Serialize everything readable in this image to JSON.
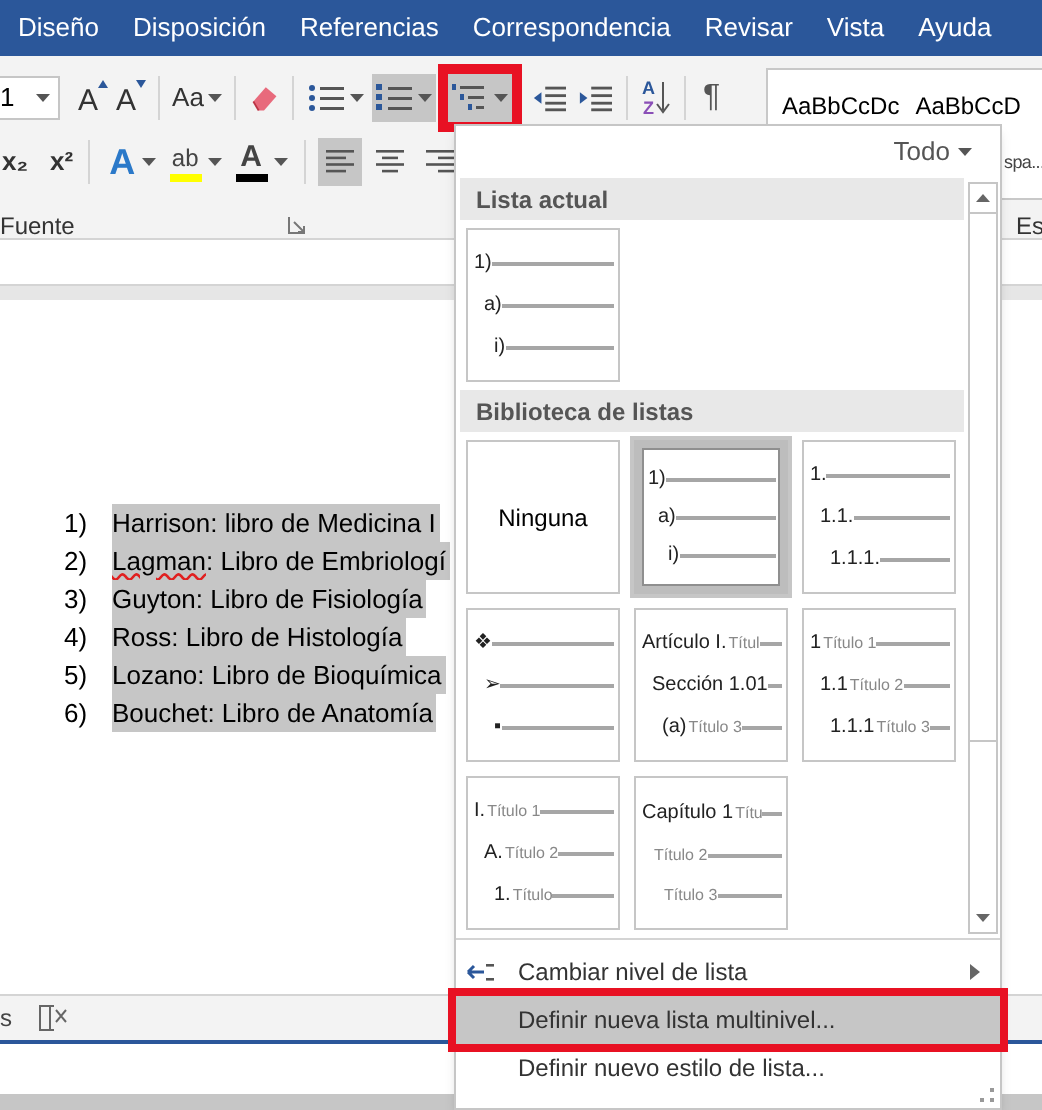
{
  "tabs": [
    {
      "label": "Diseño"
    },
    {
      "label": "Disposición"
    },
    {
      "label": "Referencias"
    },
    {
      "label": "Correspondencia"
    },
    {
      "label": "Revisar"
    },
    {
      "label": "Vista"
    },
    {
      "label": "Ayuda"
    }
  ],
  "ribbon": {
    "font_size": "1",
    "row1": [
      {
        "kind": "grow",
        "glyph": "A"
      },
      {
        "kind": "shrink",
        "glyph": "A"
      },
      {
        "kind": "sep"
      },
      {
        "kind": "case",
        "glyph": "Aa"
      },
      {
        "kind": "sep"
      },
      {
        "kind": "eraser"
      },
      {
        "kind": "sep"
      },
      {
        "kind": "bullets",
        "active": false,
        "outlined": false
      },
      {
        "kind": "numbering",
        "active": true,
        "outlined": false
      },
      {
        "kind": "multilevel",
        "active": true,
        "outlined": true
      },
      {
        "kind": "outdent"
      },
      {
        "kind": "indent"
      },
      {
        "kind": "sep"
      },
      {
        "kind": "sort",
        "glyph": "A",
        "glyph2": "Z"
      },
      {
        "kind": "sep"
      },
      {
        "kind": "pilcrow",
        "glyph": "¶"
      }
    ],
    "row2": [
      {
        "kind": "sub",
        "glyph": "x",
        "glyph2": "₂"
      },
      {
        "kind": "sup",
        "glyph": "x",
        "glyph2": "²"
      },
      {
        "kind": "sep"
      },
      {
        "kind": "effects",
        "glyph": "A"
      },
      {
        "kind": "highlight",
        "glyph": "ab"
      },
      {
        "kind": "color",
        "glyph": "A"
      },
      {
        "kind": "sep"
      },
      {
        "kind": "align_left",
        "active": true
      },
      {
        "kind": "align_center",
        "active": false
      },
      {
        "kind": "align_right",
        "active": false
      }
    ],
    "group_labels": [
      "Fuente",
      "Es"
    ],
    "styles": [
      "AaBbCcDc",
      "AaBbCcD"
    ],
    "style_caption": "spa..."
  },
  "document": {
    "items": [
      {
        "number": "1)",
        "text": "Harrison: libro de Medicina I",
        "selected": true
      },
      {
        "number": "2)",
        "misspelled": "Lagman",
        "text": ": Libro de Embriologí",
        "selected": true
      },
      {
        "number": "3)",
        "text": "Guyton: Libro de Fisiología",
        "selected": true
      },
      {
        "number": "4)",
        "text": "Ross: Libro de Histología",
        "selected": true
      },
      {
        "number": "5)",
        "text": "Lozano: Libro de Bioquímica",
        "selected": true
      },
      {
        "number": "6)",
        "text": "Bouchet: Libro de Anatomía",
        "selected": true
      }
    ]
  },
  "status_bar": {
    "text": "s"
  },
  "dropdown": {
    "filter": "Todo",
    "sections": [
      {
        "title": "Lista actual",
        "tiles": [
          {
            "kind": "levels",
            "selected": false,
            "levels": [
              {
                "label": "1)"
              },
              {
                "label": "a)"
              },
              {
                "label": "i)"
              }
            ]
          }
        ]
      },
      {
        "title": "Biblioteca de listas",
        "tiles": [
          {
            "kind": "none",
            "selected": false,
            "label": "Ninguna"
          },
          {
            "kind": "levels",
            "selected": true,
            "levels": [
              {
                "label": "1)"
              },
              {
                "label": "a)"
              },
              {
                "label": "i)"
              }
            ]
          },
          {
            "kind": "levels",
            "selected": false,
            "levels": [
              {
                "label": "1."
              },
              {
                "label": "1.1."
              },
              {
                "label": "1.1.1."
              }
            ]
          },
          {
            "kind": "levels",
            "selected": false,
            "levels": [
              {
                "label": "❖"
              },
              {
                "label": "➢"
              },
              {
                "label": "▪"
              }
            ]
          },
          {
            "kind": "levels",
            "selected": false,
            "levels": [
              {
                "label": "Artículo I.",
                "title": "Títul"
              },
              {
                "label": "Sección 1.01"
              },
              {
                "label": "(a)",
                "title": "Título 3"
              }
            ]
          },
          {
            "kind": "levels",
            "selected": false,
            "levels": [
              {
                "label": "1",
                "title": "Título 1"
              },
              {
                "label": "1.1",
                "title": "Título 2"
              },
              {
                "label": "1.1.1",
                "title": "Título 3"
              }
            ]
          },
          {
            "kind": "levels",
            "selected": false,
            "levels": [
              {
                "label": "I.",
                "title": "Título 1"
              },
              {
                "label": "A.",
                "title": "Título 2"
              },
              {
                "label": "1.",
                "title": "Título"
              }
            ]
          },
          {
            "kind": "levels",
            "selected": false,
            "levels": [
              {
                "label": "Capítulo 1",
                "title": "Títu"
              },
              {
                "title": "Título 2"
              },
              {
                "title": "Título 3"
              }
            ]
          }
        ]
      }
    ],
    "menu": [
      {
        "label": "Cambiar nivel de lista",
        "icon": true,
        "submenu": true,
        "highlighted": false,
        "outlined": false
      },
      {
        "label": "Definir nueva lista multinivel...",
        "icon": false,
        "submenu": false,
        "highlighted": true,
        "outlined": true
      },
      {
        "label": "Definir nuevo estilo de lista...",
        "icon": false,
        "submenu": false,
        "highlighted": false,
        "outlined": false
      }
    ]
  }
}
